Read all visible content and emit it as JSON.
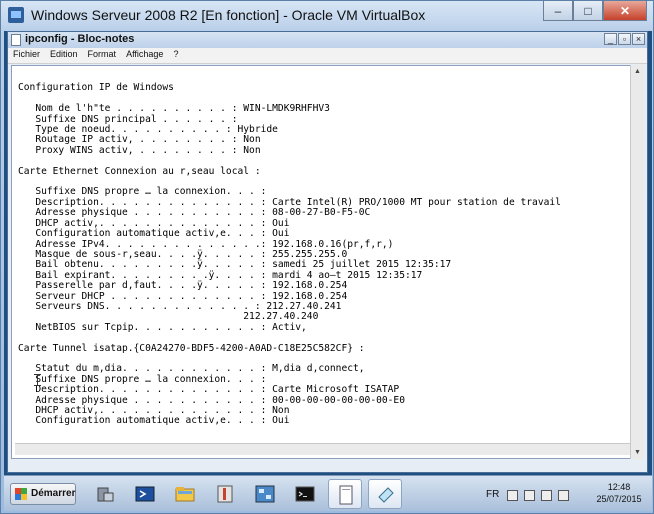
{
  "vbox": {
    "title": "Windows Serveur 2008 R2 [En fonction] - Oracle VM VirtualBox",
    "controls": {
      "minimize": "–",
      "maximize": "□",
      "close": "✕"
    }
  },
  "notepad": {
    "title": "ipconfig - Bloc-notes",
    "controls": {
      "minimize": "_",
      "maximize": "▫",
      "close": "×"
    },
    "menu": [
      "Fichier",
      "Edition",
      "Format",
      "Affichage",
      "?"
    ],
    "content_lines": [
      "",
      "Configuration IP de Windows",
      "",
      "   Nom de l'h\"te . . . . . . . . . . : WIN-LMDK9RHFHV3",
      "   Suffixe DNS principal . . . . . . :",
      "   Type de noeud. . . . . . . . . . : Hybride",
      "   Routage IP activ, . . . . . . . . : Non",
      "   Proxy WINS activ, . . . . . . . . : Non",
      "",
      "Carte Ethernet Connexion au r,seau local :",
      "",
      "   Suffixe DNS propre … la connexion. . . :",
      "   Description. . . . . . . . . . . . . . : Carte Intel(R) PRO/1000 MT pour station de travail",
      "   Adresse physique . . . . . . . . . . . : 08-00-27-B0-F5-0C",
      "   DHCP activ,. . . . . . . . . . . . . . : Oui",
      "   Configuration automatique activ,e. . . : Oui",
      "   Adresse IPv4. . . . . . . . . . . . . .: 192.168.0.16(pr,f,r,)",
      "   Masque de sous-r,seau. . . .ÿ. . . . . : 255.255.255.0",
      "   Bail obtenu. . . . . . . . .ÿ. . . . . : samedi 25 juillet 2015 12:35:17",
      "   Bail expirant. . . . . . . . .ÿ. . . . : mardi 4 ao–t 2015 12:35:17",
      "   Passerelle par d,faut. . . .ÿ. . . . . : 192.168.0.254",
      "   Serveur DHCP . . . . . . . . . . . . . : 192.168.0.254",
      "   Serveurs DNS. . . . . . . . . . . . . : 212.27.40.241",
      "                                       212.27.40.240",
      "   NetBIOS sur Tcpip. . . . . . . . . . . : Activ,",
      "",
      "Carte Tunnel isatap.{C0A24270-BDF5-4200-A0AD-C18E25C582CF} :",
      "",
      "   Statut du m,dia. . . . . . . . . . . . : M,dia d,connect,",
      "   Suffixe DNS propre … la connexion. . . :",
      "   Description. . . . . . . . . . . . . . : Carte Microsoft ISATAP",
      "   Adresse physique . . . . . . . . . . . : 00-00-00-00-00-00-00-E0",
      "   DHCP activ,. . . . . . . . . . . . . . : Non",
      "   Configuration automatique activ,e. . . : Oui"
    ]
  },
  "taskbar": {
    "start_label": "Démarrer",
    "apps": [
      {
        "icon": "server-manager-icon",
        "active": false
      },
      {
        "icon": "powershell-icon",
        "active": false
      },
      {
        "icon": "explorer-folder-icon",
        "active": false
      },
      {
        "icon": "admin-tools-icon",
        "active": false
      },
      {
        "icon": "network-connections-icon",
        "active": false
      },
      {
        "icon": "cmd-icon",
        "active": false
      },
      {
        "icon": "notepad-document-icon",
        "active": true
      },
      {
        "icon": "notepad-icon",
        "active": true
      }
    ],
    "language": "FR",
    "time": "12:48",
    "date": "25/07/2015"
  }
}
